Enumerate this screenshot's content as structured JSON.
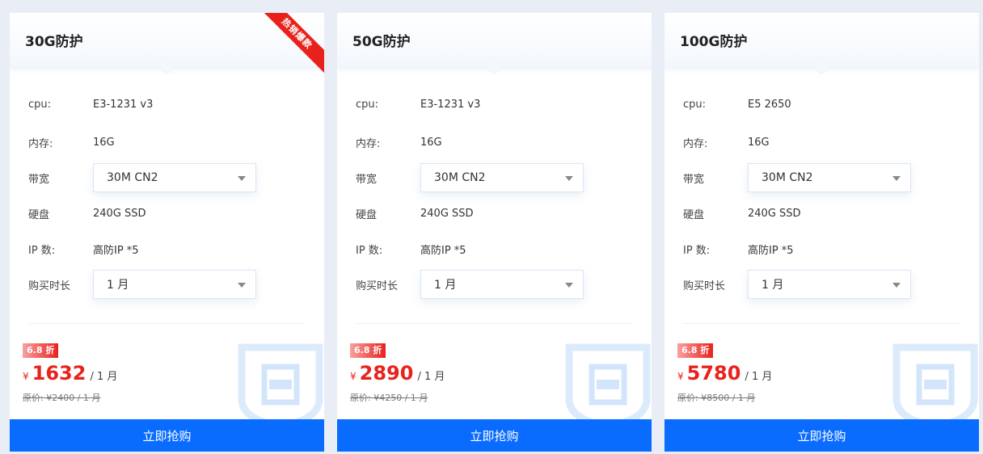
{
  "plans": [
    {
      "title": "30G防护",
      "ribbon": "热销爆款",
      "cpu_label": "cpu:",
      "cpu": "E3-1231 v3",
      "mem_label": "内存:",
      "mem": "16G",
      "bw_label": "带宽",
      "bw": "30M CN2",
      "disk_label": "硬盘",
      "disk": "240G SSD",
      "ip_label": "IP 数:",
      "ip": "高防IP *5",
      "dur_label": "购买时长",
      "dur": "1 月",
      "discount": "6.8 折",
      "currency": "¥",
      "price": "1632",
      "per": "/ 1 月",
      "original": "原价: ¥2400 / 1 月",
      "buy": "立即抢购"
    },
    {
      "title": "50G防护",
      "cpu_label": "cpu:",
      "cpu": "E3-1231 v3",
      "mem_label": "内存:",
      "mem": "16G",
      "bw_label": "带宽",
      "bw": "30M CN2",
      "disk_label": "硬盘",
      "disk": "240G SSD",
      "ip_label": "IP 数:",
      "ip": "高防IP *5",
      "dur_label": "购买时长",
      "dur": "1 月",
      "discount": "6.8 折",
      "currency": "¥",
      "price": "2890",
      "per": "/ 1 月",
      "original": "原价: ¥4250 / 1 月",
      "buy": "立即抢购"
    },
    {
      "title": "100G防护",
      "cpu_label": "cpu:",
      "cpu": "E5 2650",
      "mem_label": "内存:",
      "mem": "16G",
      "bw_label": "带宽",
      "bw": "30M CN2",
      "disk_label": "硬盘",
      "disk": "240G SSD",
      "ip_label": "IP 数:",
      "ip": "高防IP *5",
      "dur_label": "购买时长",
      "dur": "1 月",
      "discount": "6.8 折",
      "currency": "¥",
      "price": "5780",
      "per": "/ 1 月",
      "original": "原价: ¥8500 / 1 月",
      "buy": "立即抢购"
    }
  ],
  "colors": {
    "accent": "#0a6cff",
    "price": "#e8221b",
    "background": "#e9eef6",
    "ribbon": "#e8221b"
  },
  "icons": {
    "select_caret": "caret-down-icon",
    "watermark": "shield-icon"
  }
}
